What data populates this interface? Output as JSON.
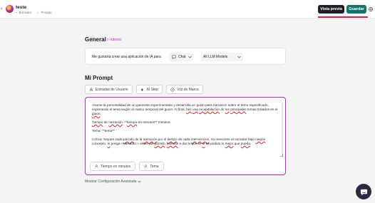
{
  "header": {
    "back_glyph": "‹",
    "project_title": "teste",
    "status": "Borrador",
    "visibility": "Privado",
    "preview_label": "Vista previa",
    "save_label": "Guardar"
  },
  "general": {
    "title": "General",
    "tutorial_label": "tutorial",
    "tutorial_glyph": "▷",
    "lead_text": "Me gustaría crear una aplicación de IA para",
    "app_type": "Chat",
    "model": "All LLM Models"
  },
  "prompt": {
    "title": "Mi Prompt",
    "tabs": [
      "Entradas de Usuario",
      "AI Step",
      "Voz de Marca"
    ],
    "text": {
      "p1_a": "Asume la personalidad de un guionista experimentado y desarrolla un guion para narración sobre el tema especificado, explorando el tema según el marco temporal del guion. Al final, ",
      "p1_w1": "haz",
      "p1_s1": " ",
      "p1_w2": "una",
      "p1_s2": " ",
      "p1_w3": "recapitulación",
      "p1_s3": " de ",
      "p1_w4": "los",
      "p1_s4": " ",
      "p1_w5": "principales",
      "p1_b": " temas tratados en el ",
      "p1_w6": "guion",
      "p1_end": ".",
      "p2_w1": "Tiempo",
      "p2_a": " de ",
      "p2_w2": "narración",
      "p2_b": ": **",
      "p2_w3": "tiempo",
      "p2_c": "-en-minutos** minutos.",
      "p3": "Tema: **tema**",
      "p4_a": "Crítica: Separe cada ",
      "p4_w1": "párrafo",
      "p4_b": " de la ",
      "p4_w2": "narración",
      "p4_c": " por el ",
      "p4_w3": "tiempo",
      "p4_d": " de cada ",
      "p4_w4": "intervención",
      "p4_e": ", no mencione al narrador bajo ",
      "p4_w5": "ningún",
      "p4_f": " concepto, ",
      "p4_w6": "ni",
      "p4_g": " ponga «Narrador:» antes del ",
      "p4_w7": "párrafo",
      "p4_h": ", ",
      "p4_w8": "límitese",
      "p4_i": " a dar lo que se ",
      "p4_w9": "le",
      "p4_j": " ha pedido lo ",
      "p4_w10": "mejor",
      "p4_k": " que ",
      "p4_w11": "pueda",
      "p4_end": "."
    },
    "variables": [
      "Tiempo en minutos",
      "Tema"
    ]
  },
  "advanced_label": "Mostrar Configuración Avanzada",
  "colors": {
    "accent": "#c026d3",
    "save": "#0f766e",
    "preview": "#1f1f23",
    "fab": "#2b2940"
  }
}
